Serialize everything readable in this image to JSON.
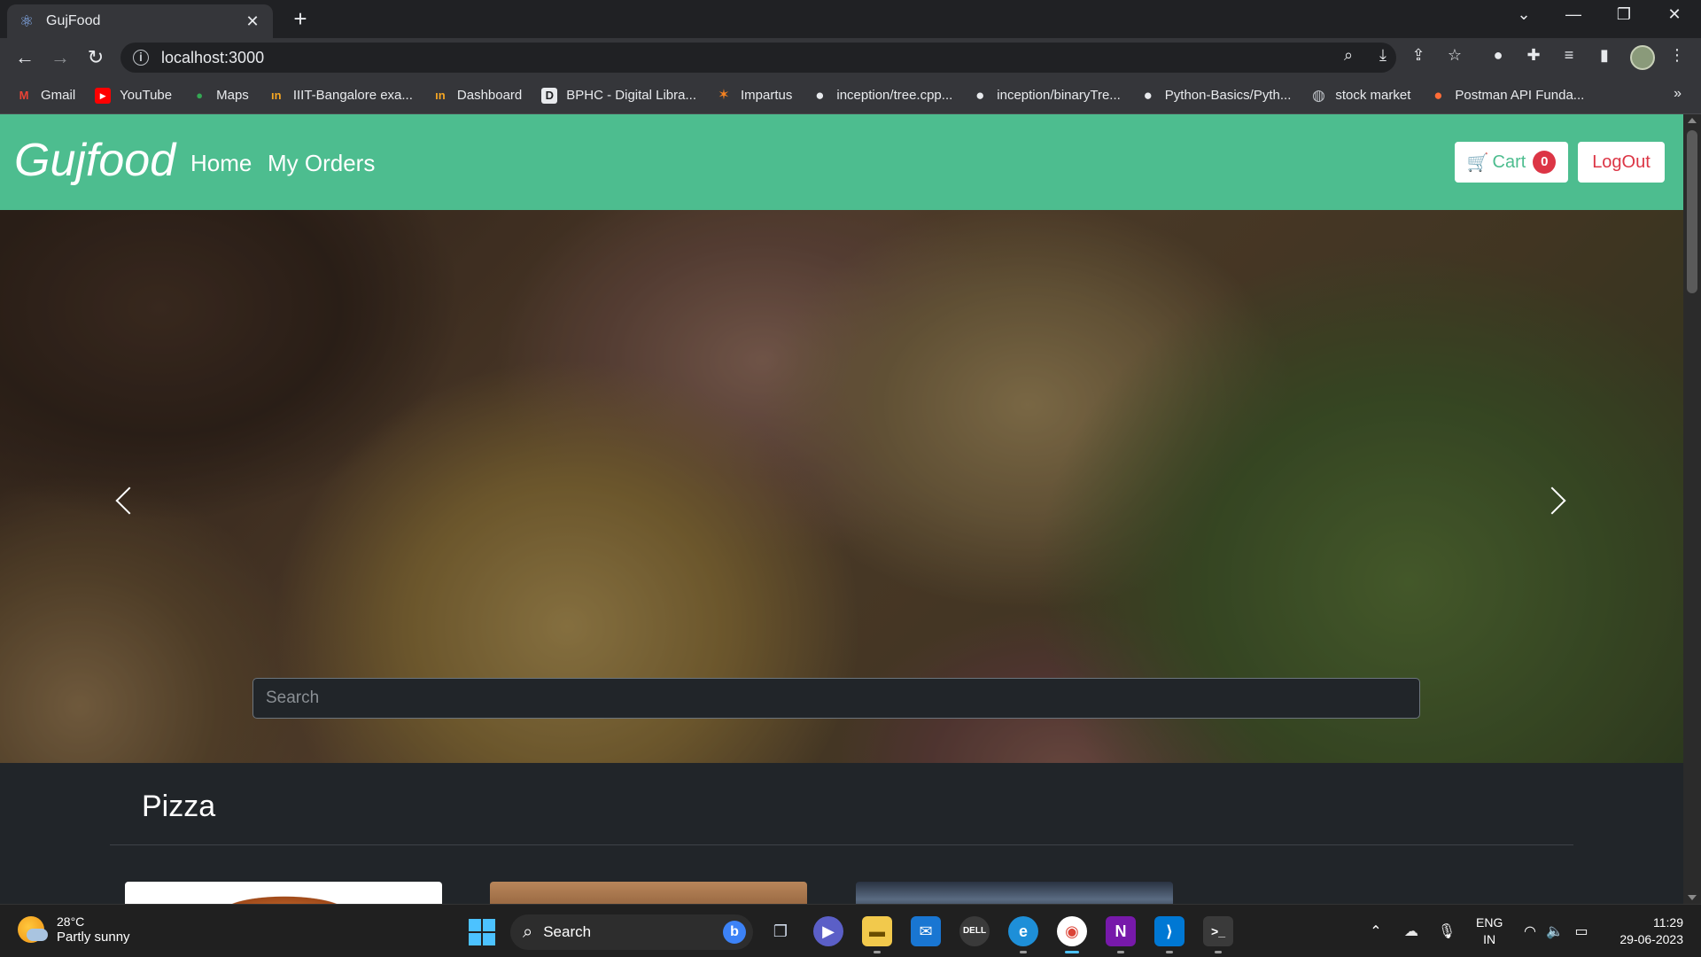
{
  "browser": {
    "tab_title": "GujFood",
    "tab_close": "✕",
    "new_tab": "+",
    "url": "localhost:3000",
    "window_controls": [
      "⌄",
      "—",
      "❐",
      "✕"
    ]
  },
  "bookmarks": [
    {
      "label": "Gmail",
      "icon": "gmail-icon",
      "glyph": "M",
      "color": "#ea4335"
    },
    {
      "label": "YouTube",
      "icon": "youtube-icon",
      "glyph": "▶",
      "color": "#ff0000"
    },
    {
      "label": "Maps",
      "icon": "maps-icon",
      "glyph": "●",
      "color": "#34a853"
    },
    {
      "label": "IIIT-Bangalore exa...",
      "icon": "iiitb-icon",
      "glyph": "ın",
      "color": "#f5a623"
    },
    {
      "label": "Dashboard",
      "icon": "dashboard-icon",
      "glyph": "ın",
      "color": "#f5a623"
    },
    {
      "label": "BPHC - Digital Libra...",
      "icon": "bphc-icon",
      "glyph": "D",
      "color": "#e8eaed"
    },
    {
      "label": "Impartus",
      "icon": "impartus-icon",
      "glyph": "✶",
      "color": "#f58220"
    },
    {
      "label": "inception/tree.cpp...",
      "icon": "github-icon",
      "glyph": "●",
      "color": "#e8eaed"
    },
    {
      "label": "inception/binaryTre...",
      "icon": "github-icon",
      "glyph": "●",
      "color": "#e8eaed"
    },
    {
      "label": "Python-Basics/Pyth...",
      "icon": "github-icon",
      "glyph": "●",
      "color": "#e8eaed"
    },
    {
      "label": "stock market",
      "icon": "globe-icon",
      "glyph": "◍",
      "color": "#bdc1c6"
    },
    {
      "label": "Postman API Funda...",
      "icon": "postman-icon",
      "glyph": "●",
      "color": "#ff6c37"
    }
  ],
  "bookmarks_more": "»",
  "app": {
    "brand": "Gujfood",
    "nav": {
      "home": "Home",
      "orders": "My Orders"
    },
    "cart_label": "Cart",
    "cart_count": "0",
    "logout_label": "LogOut",
    "search_placeholder": "Search",
    "category": "Pizza",
    "accent_color": "#4dbd8f",
    "danger_color": "#dc3545"
  },
  "taskbar": {
    "temperature": "28°C",
    "condition": "Partly sunny",
    "search_label": "Search",
    "lang_line1": "ENG",
    "lang_line2": "IN",
    "time": "11:29",
    "date": "29-06-2023"
  }
}
